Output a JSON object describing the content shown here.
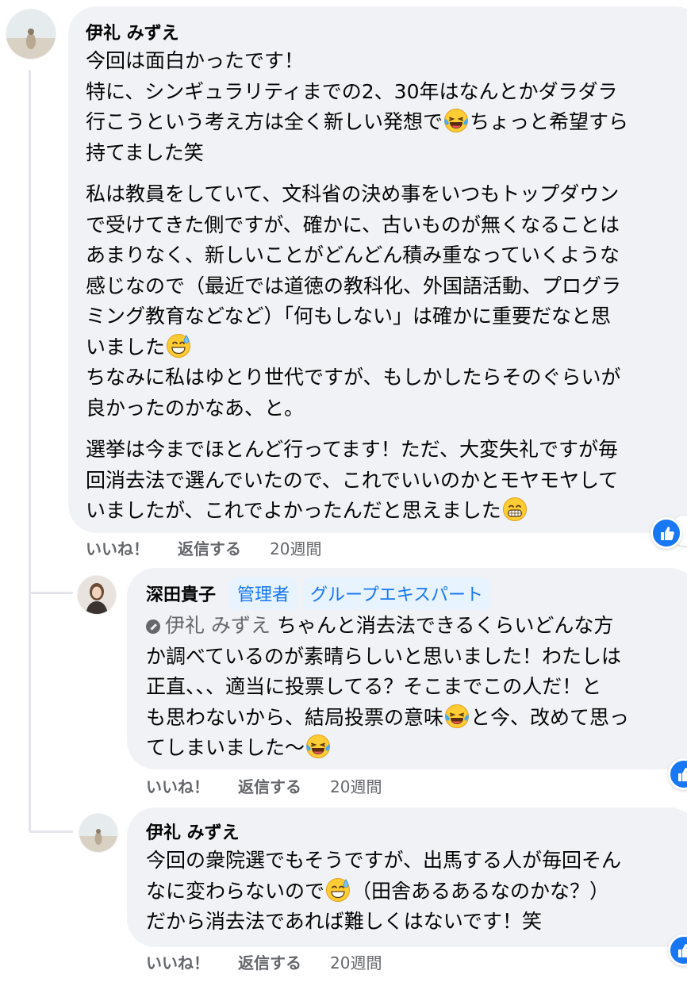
{
  "thread": {
    "comment": {
      "author": "伊礼 みずえ",
      "paragraphs": [
        [
          [
            {
              "t": "今回は面白かったです！"
            }
          ],
          [
            {
              "t": "特に、シンギュラリティまでの2、30年はなんとかダラダラ"
            }
          ],
          [
            {
              "t": "行こうという考え方は全く新しい発想で"
            },
            {
              "e": "laughing-tears"
            },
            {
              "t": "ちょっと希望すら"
            }
          ],
          [
            {
              "t": "持てました笑"
            }
          ]
        ],
        [
          [
            {
              "t": "私は教員をしていて、文科省の決め事をいつもトップダウン"
            }
          ],
          [
            {
              "t": "で受けてきた側ですが、確かに、古いものが無くなることは"
            }
          ],
          [
            {
              "t": "あまりなく、新しいことがどんどん積み重なっていくような"
            }
          ],
          [
            {
              "t": "感じなので（最近では道徳の教科化、外国語活動、プログラ"
            }
          ],
          [
            {
              "t": "ミング教育などなど）「何もしない」は確かに重要だなと思"
            }
          ],
          [
            {
              "t": "いました"
            },
            {
              "e": "sweat-smile"
            }
          ],
          [
            {
              "t": "ちなみに私はゆとり世代ですが、もしかしたらそのぐらいが"
            }
          ],
          [
            {
              "t": "良かったのかなあ、と。"
            }
          ]
        ],
        [
          [
            {
              "t": "選挙は今までほとんど行ってます！ただ、大変失礼ですが毎"
            }
          ],
          [
            {
              "t": "回消去法で選んでいたので、これでいいのかとモヤモヤして"
            }
          ],
          [
            {
              "t": "いましたが、これでよかったんだと思えました"
            },
            {
              "e": "grin"
            }
          ]
        ]
      ],
      "actions": {
        "like": "いいね！",
        "reply": "返信する",
        "time": "20週間"
      }
    },
    "reply1": {
      "author": "深田貴子",
      "badges": [
        "管理者",
        "グループエキスパート"
      ],
      "mention": "伊礼 みずえ",
      "lines": [
        [
          {
            "t": " ちゃんと消去法できるくらいどんな方"
          }
        ],
        [
          {
            "t": "か調べているのが素晴らしいと思いました！わたしは"
          }
        ],
        [
          {
            "t": "正直、、、適当に投票してる？そこまでこの人だ！と"
          }
        ],
        [
          {
            "t": "も思わないから、結局投票の意味"
          },
          {
            "e": "laughing-tears"
          },
          {
            "t": "と今、改めて思っ"
          }
        ],
        [
          {
            "t": "てしまいました〜"
          },
          {
            "e": "laughing-tears"
          }
        ]
      ],
      "actions": {
        "like": "いいね！",
        "reply": "返信する",
        "time": "20週間"
      }
    },
    "reply2": {
      "author": "伊礼 みずえ",
      "lines": [
        [
          {
            "t": "今回の衆院選でもそうですが、出馬する人が毎回そん"
          }
        ],
        [
          {
            "t": "なに変わらないので"
          },
          {
            "e": "sweat-smile"
          },
          {
            "t": "（田舎あるあるなのかな？）"
          }
        ],
        [
          {
            "t": "だから消去法であれば難しくはないです！笑"
          }
        ]
      ],
      "actions": {
        "like": "いいね！",
        "reply": "返信する",
        "time": "20週間"
      }
    },
    "reaction_icon": "thumbs-up-icon",
    "colors": {
      "bubble": "#f0f2f5",
      "badge_bg": "#e7f3ff",
      "badge_text": "#1877f2",
      "muted": "#65676b",
      "like_blue": "#1877f2"
    }
  }
}
